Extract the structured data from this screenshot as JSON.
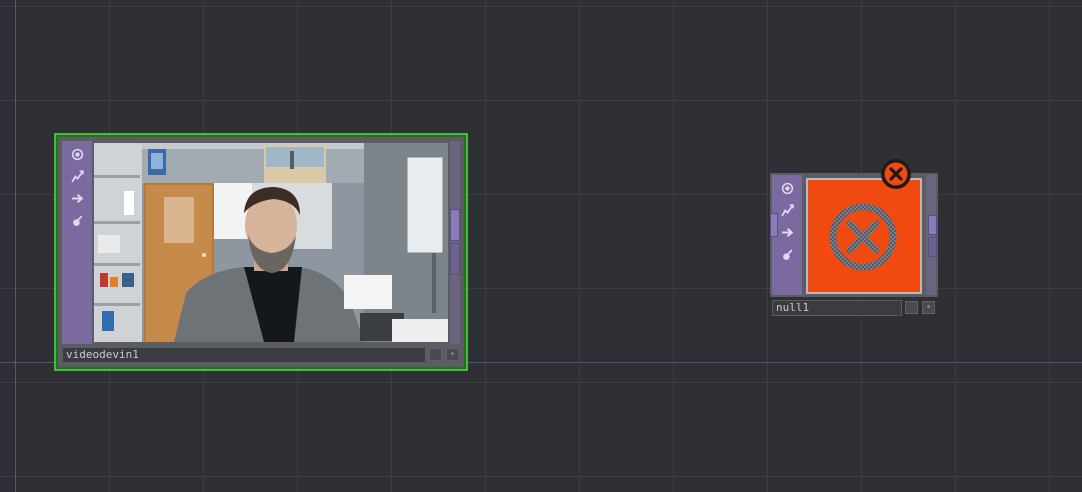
{
  "network": {
    "nodes": [
      {
        "name": "videodevin1",
        "type_icon": "camera-video-icon",
        "selected": true,
        "selection_color": "#3fbf3a"
      },
      {
        "name": "null1",
        "type_icon": "null-icon",
        "error": true,
        "preview_color": "#f04a10",
        "error_icon": "error-x-circle-icon"
      }
    ]
  },
  "op_buttons": [
    "viewer-icon",
    "cook-icon",
    "export-icon",
    "lock-icon"
  ],
  "colors": {
    "background": "#2f3035",
    "node_strip": "#7a6aa0",
    "selection": "#3fbf3a",
    "error_preview": "#f04a10"
  }
}
